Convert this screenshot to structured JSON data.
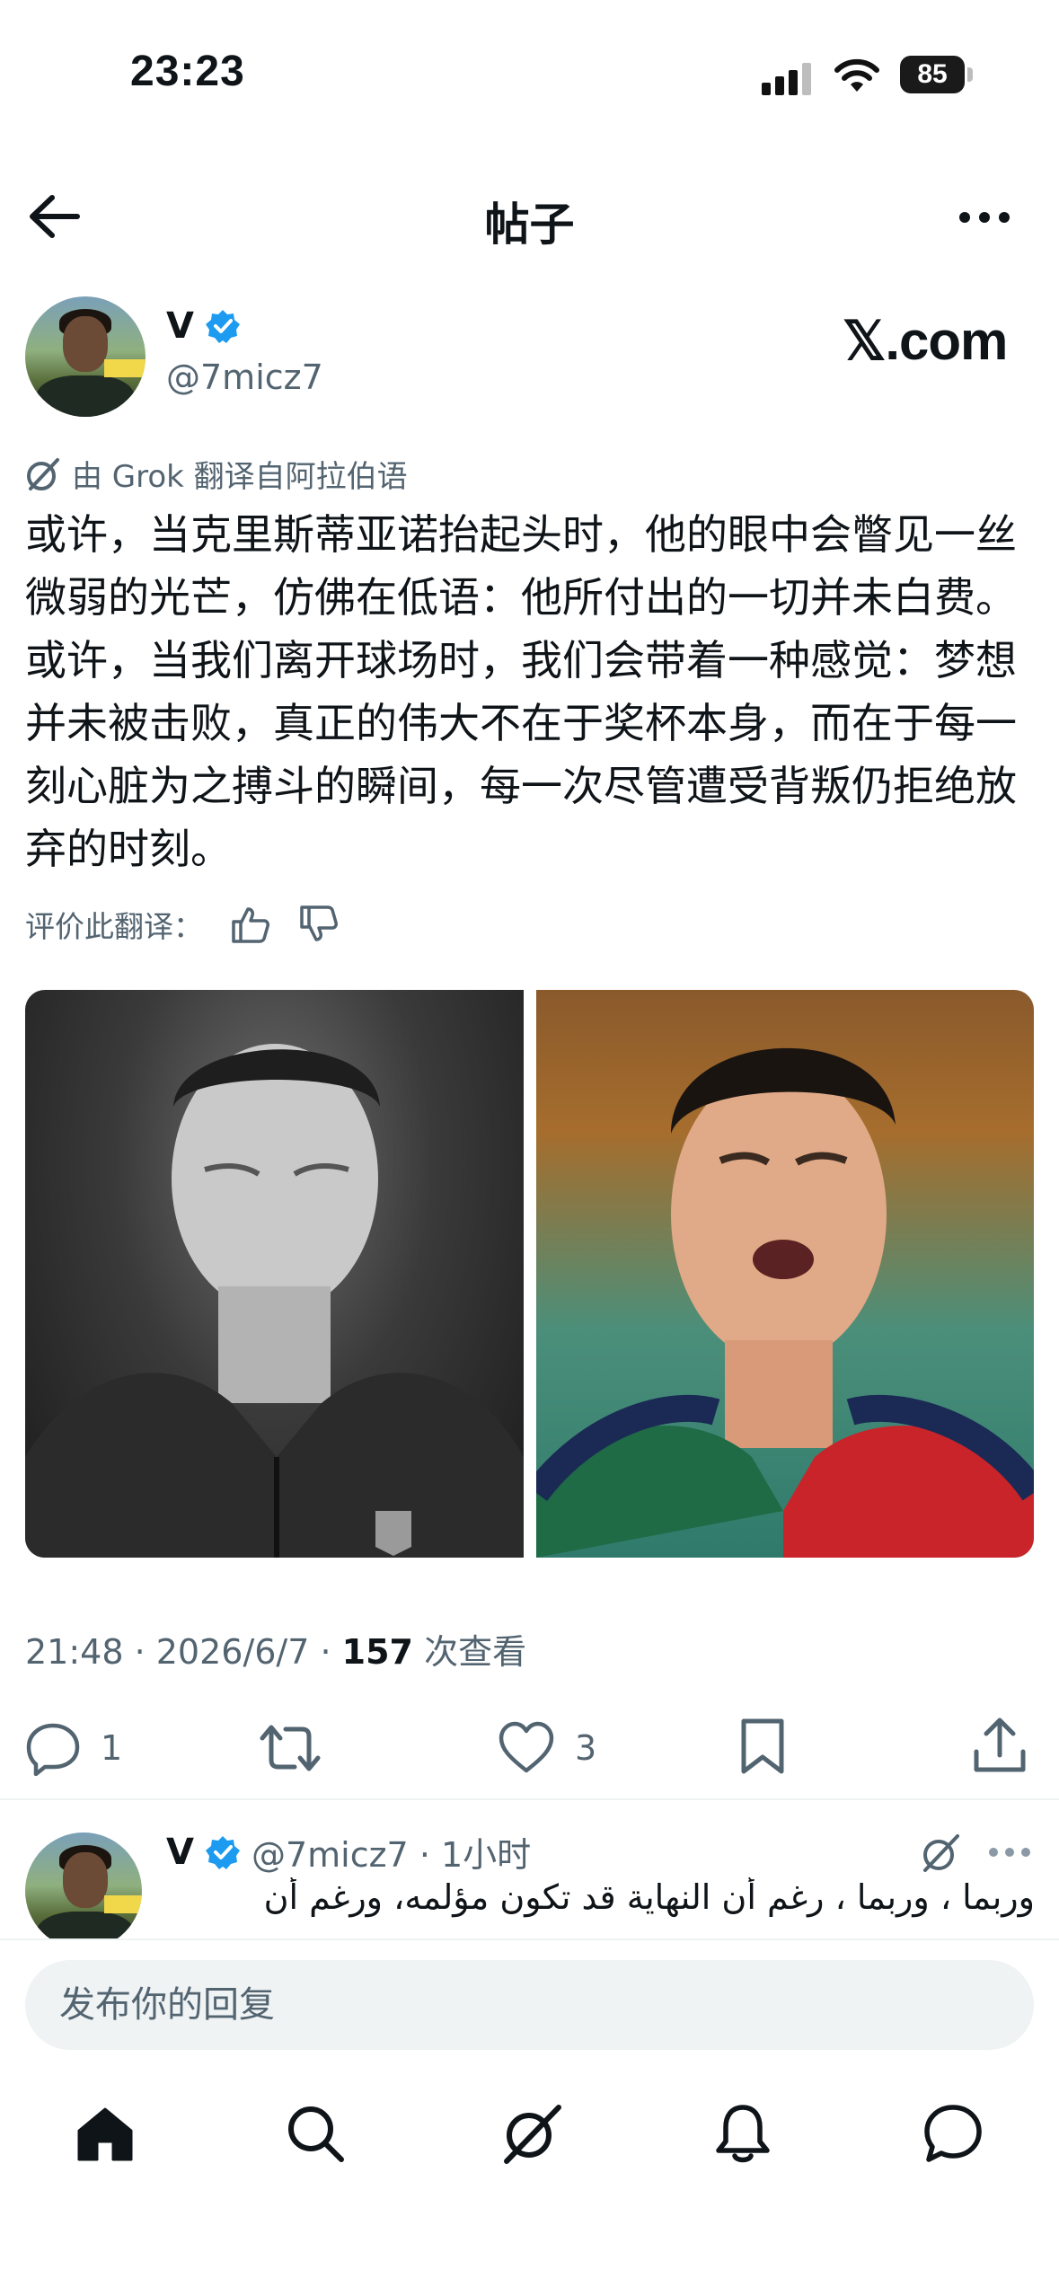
{
  "status_bar": {
    "time": "23:23",
    "battery": "85"
  },
  "header": {
    "title": "帖子"
  },
  "post": {
    "author_name": "V",
    "author_handle": "@7micz7",
    "watermark": "𝕏.com",
    "translation_note": "由 Grok 翻译自阿拉伯语",
    "text": "或许，当克里斯蒂亚诺抬起头时，他的眼中会瞥见一丝微弱的光芒，仿佛在低语：他所付出的一切并未白费。或许，当我们离开球场时，我们会带着一种感觉：梦想并未被击败，真正的伟大不在于奖杯本身，而在于每一刻心脏为之搏斗的瞬间，每一次尽管遭受背叛仍拒绝放弃的时刻。",
    "rate_label": "评价此翻译：",
    "meta_time": "21:48 · 2026/6/7 · ",
    "meta_views": "157",
    "meta_views_label": " 次查看",
    "actions": {
      "replies": "1",
      "likes": "3"
    }
  },
  "reply": {
    "author_name": "V",
    "handle_time": "@7micz7 · 1小时",
    "text": "وربما ، وربما ، رغم أن النهاية قد تكون مؤلمه، ورغم أن"
  },
  "composer": {
    "placeholder": "发布你的回复"
  },
  "icons": [
    "back-arrow-icon",
    "more-icon",
    "verified-badge-icon",
    "grok-icon",
    "thumbs-up-icon",
    "thumbs-down-icon",
    "reply-icon",
    "retweet-icon",
    "like-icon",
    "bookmark-icon",
    "share-icon",
    "home-icon",
    "search-icon",
    "grok-tab-icon",
    "bell-icon",
    "messages-icon"
  ],
  "colors": {
    "accent": "#1d9bf0",
    "text": "#0f1419",
    "secondary": "#536471"
  }
}
